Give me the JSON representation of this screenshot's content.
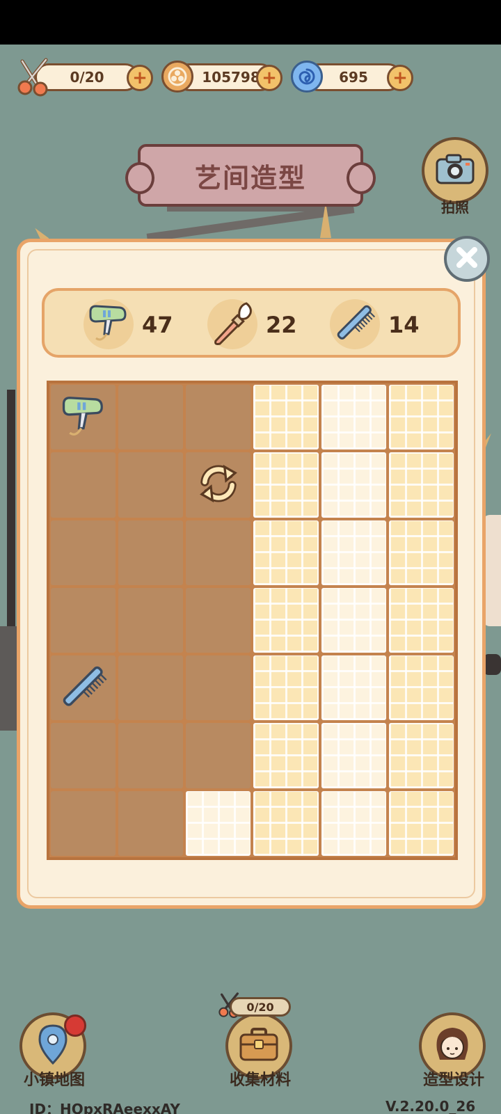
{
  "resources": {
    "scissors": {
      "value": "0/20",
      "icon": "scissors-icon"
    },
    "coins": {
      "value": "105798",
      "icon": "coin-icon"
    },
    "gems": {
      "value": "695",
      "icon": "swirl-gem-icon"
    }
  },
  "title": "艺间造型",
  "camera": {
    "label": "拍照",
    "icon": "camera-icon"
  },
  "tools": [
    {
      "icon": "hair-dryer-icon",
      "count": "47"
    },
    {
      "icon": "makeup-brush-icon",
      "count": "22"
    },
    {
      "icon": "comb-icon",
      "count": "14"
    }
  ],
  "grid": {
    "columns": 6,
    "rows": 7,
    "items": [
      {
        "row": 0,
        "col": 0,
        "icon": "hair-dryer-icon"
      },
      {
        "row": 1,
        "col": 2,
        "icon": "refresh-icon"
      },
      {
        "row": 4,
        "col": 0,
        "icon": "comb-icon"
      }
    ]
  },
  "nav": {
    "map_label": "小镇地图",
    "collect_label": "收集材料",
    "collect_counter": "0/20",
    "design_label": "造型设计"
  },
  "footer": {
    "id_text": "ID：HQpxRAeexxAY",
    "version_text": "V.2.20.0_26"
  }
}
